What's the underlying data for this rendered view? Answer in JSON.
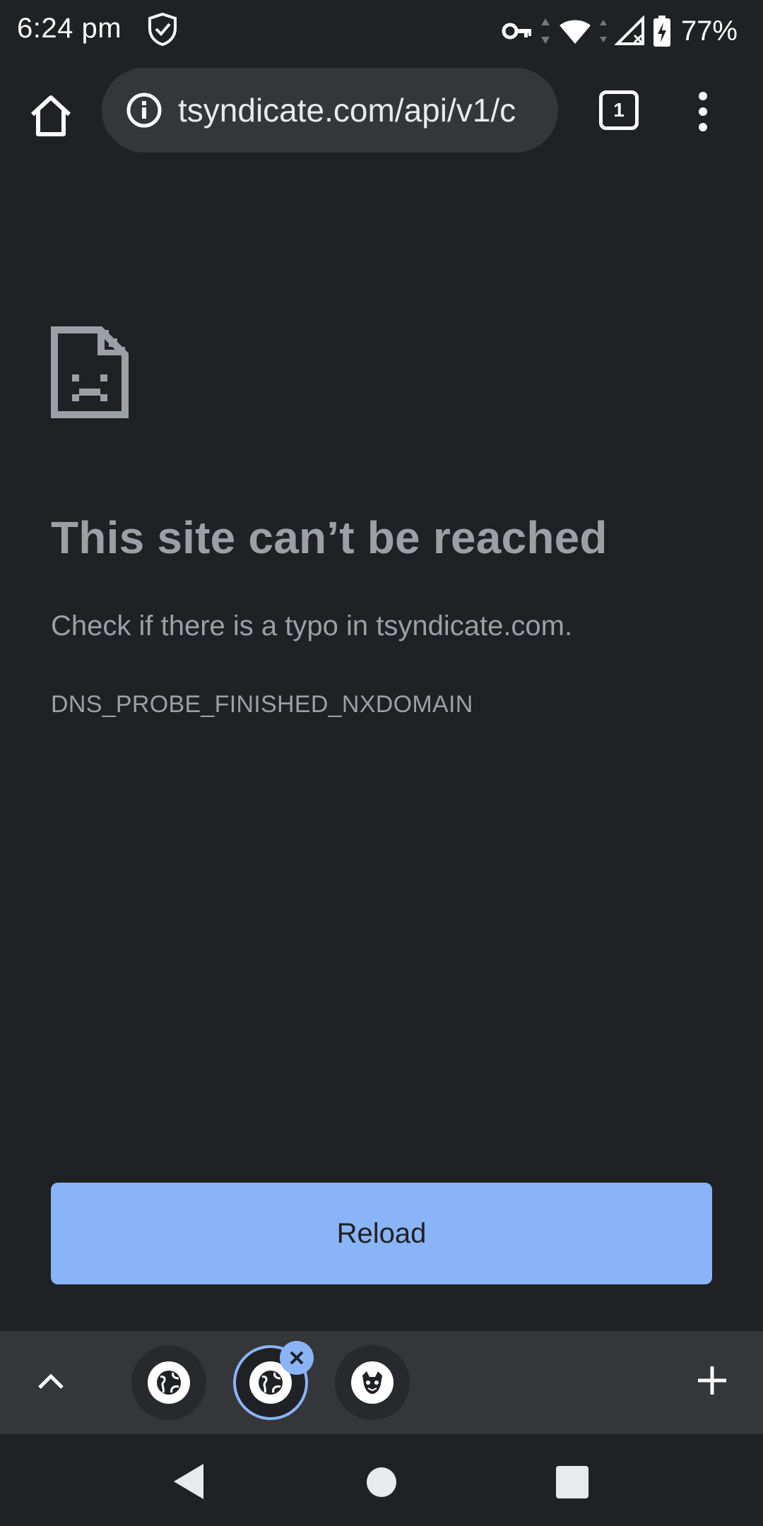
{
  "status_bar": {
    "time": "6:24 pm",
    "battery_percent": "77%",
    "icons": [
      "shield-icon",
      "vpn-key-icon",
      "wifi-icon",
      "signal-off-icon",
      "battery-charging-icon"
    ]
  },
  "toolbar": {
    "url": "tsyndicate.com/api/v1/c",
    "tab_count": "1",
    "icons": [
      "home-icon",
      "info-icon",
      "tab-switcher-icon",
      "more-vert-icon"
    ]
  },
  "error_page": {
    "title": "This site can’t be reached",
    "description": "Check if there is a typo in tsyndicate.com.",
    "error_code": "DNS_PROBE_FINISHED_NXDOMAIN",
    "reload_label": "Reload",
    "icon": "sad-document-icon"
  },
  "tab_strip": {
    "tabs": [
      {
        "icon": "globe-icon",
        "active": false
      },
      {
        "icon": "globe-icon",
        "active": true
      },
      {
        "icon": "mascot-icon",
        "active": false
      }
    ],
    "icons": [
      "chevron-up-icon",
      "close-icon",
      "plus-icon"
    ]
  },
  "nav_bar": {
    "icons": [
      "back-icon",
      "home-circle-icon",
      "recents-icon"
    ]
  },
  "colors": {
    "background": "#202124",
    "omnibox": "#35363a",
    "accent": "#8ab4f8",
    "muted_text": "#9aa0a6"
  }
}
